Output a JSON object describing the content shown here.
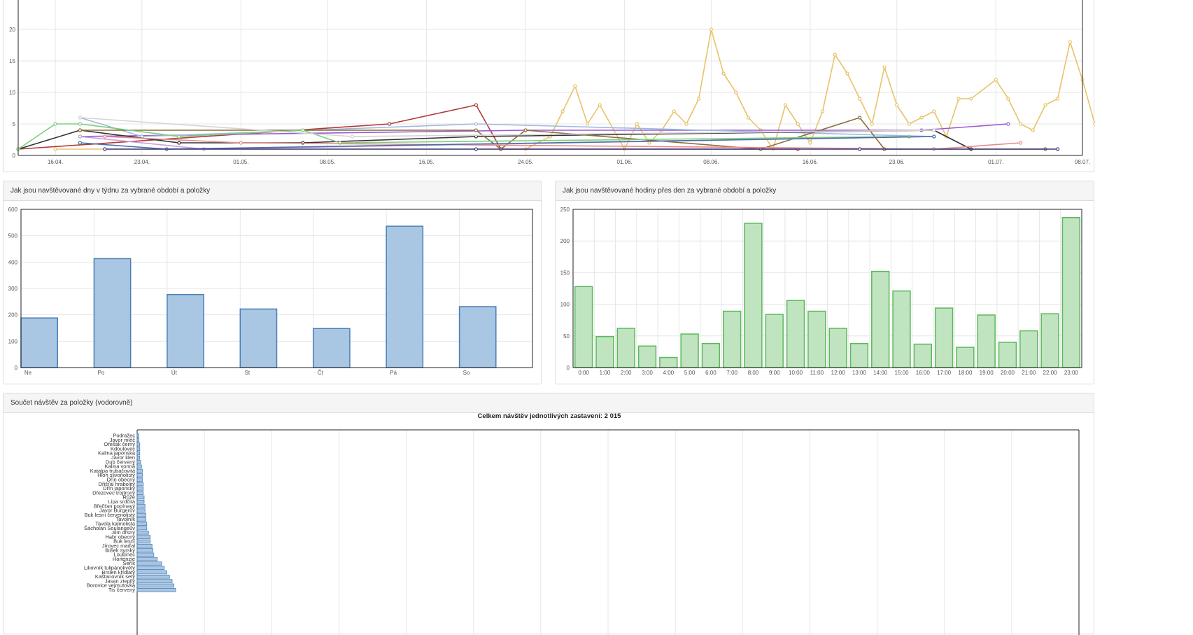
{
  "line_panel": {
    "chart_data": {
      "type": "line",
      "ylim": [
        0,
        25
      ],
      "yticks": [
        "0",
        "5",
        "10",
        "15",
        "20"
      ],
      "x_dates": [
        "16.04.",
        "23.04.",
        "01.05.",
        "08.05.",
        "16.05.",
        "24.05.",
        "01.06.",
        "08.06.",
        "16.06.",
        "23.06.",
        "01.07.",
        "08.07."
      ],
      "xlim": [
        "2018-04-13",
        "2018-07-08"
      ],
      "grid": true,
      "series": [
        {
          "color": "#e8c36a",
          "points": [
            [
              "2018-04-16",
              1
            ],
            [
              "2018-05-24",
              1
            ],
            [
              "2018-05-26",
              3
            ],
            [
              "2018-05-27",
              7
            ],
            [
              "2018-05-28",
              11
            ],
            [
              "2018-05-29",
              5
            ],
            [
              "2018-05-30",
              8
            ],
            [
              "2018-06-01",
              1
            ],
            [
              "2018-06-02",
              5
            ],
            [
              "2018-06-03",
              2
            ],
            [
              "2018-06-04",
              4
            ],
            [
              "2018-06-05",
              7
            ],
            [
              "2018-06-06",
              5
            ],
            [
              "2018-06-07",
              9
            ],
            [
              "2018-06-08",
              20
            ],
            [
              "2018-06-09",
              13
            ],
            [
              "2018-06-10",
              10
            ],
            [
              "2018-06-11",
              6
            ],
            [
              "2018-06-12",
              4
            ],
            [
              "2018-06-13",
              1
            ],
            [
              "2018-06-14",
              8
            ],
            [
              "2018-06-15",
              5
            ],
            [
              "2018-06-16",
              2
            ],
            [
              "2018-06-17",
              7
            ],
            [
              "2018-06-18",
              16
            ],
            [
              "2018-06-19",
              13
            ],
            [
              "2018-06-20",
              9
            ],
            [
              "2018-06-21",
              5
            ],
            [
              "2018-06-22",
              14
            ],
            [
              "2018-06-23",
              8
            ],
            [
              "2018-06-24",
              5
            ],
            [
              "2018-06-25",
              6
            ],
            [
              "2018-06-26",
              7
            ],
            [
              "2018-06-27",
              3
            ],
            [
              "2018-06-28",
              9
            ],
            [
              "2018-06-29",
              9
            ],
            [
              "2018-07-01",
              12
            ],
            [
              "2018-07-02",
              9
            ],
            [
              "2018-07-03",
              5
            ],
            [
              "2018-07-04",
              4
            ],
            [
              "2018-07-05",
              8
            ],
            [
              "2018-07-06",
              9
            ],
            [
              "2018-07-07",
              18
            ],
            [
              "2018-07-08",
              12
            ],
            [
              "2018-07-09",
              5
            ]
          ]
        },
        {
          "color": "#b03a3a",
          "points": [
            [
              "2018-04-13",
              1
            ],
            [
              "2018-05-13",
              5
            ],
            [
              "2018-05-20",
              8
            ],
            [
              "2018-05-22",
              1
            ],
            [
              "2018-06-15",
              1
            ]
          ]
        },
        {
          "color": "#9b59d6",
          "points": [
            [
              "2018-04-18",
              3
            ],
            [
              "2018-05-24",
              4
            ],
            [
              "2018-06-25",
              4
            ],
            [
              "2018-07-02",
              5
            ]
          ]
        },
        {
          "color": "#a0b8e0",
          "points": [
            [
              "2018-04-18",
              6
            ],
            [
              "2018-04-23",
              3
            ],
            [
              "2018-05-20",
              5
            ],
            [
              "2018-06-26",
              3
            ]
          ]
        },
        {
          "color": "#333333",
          "points": [
            [
              "2018-04-13",
              1
            ],
            [
              "2018-04-18",
              4
            ],
            [
              "2018-04-26",
              2
            ],
            [
              "2018-05-06",
              2
            ],
            [
              "2018-05-20",
              3
            ],
            [
              "2018-06-26",
              4
            ],
            [
              "2018-06-29",
              1
            ]
          ]
        },
        {
          "color": "#8c6d3a",
          "points": [
            [
              "2018-04-18",
              4
            ],
            [
              "2018-05-20",
              4
            ],
            [
              "2018-05-22",
              1
            ],
            [
              "2018-05-24",
              4
            ],
            [
              "2018-06-12",
              1
            ],
            [
              "2018-06-20",
              6
            ],
            [
              "2018-06-22",
              1
            ],
            [
              "2018-07-05",
              1
            ]
          ]
        },
        {
          "color": "#7ccf7c",
          "points": [
            [
              "2018-04-13",
              1
            ],
            [
              "2018-04-16",
              5
            ],
            [
              "2018-04-18",
              5
            ],
            [
              "2018-04-26",
              3
            ],
            [
              "2018-05-06",
              4
            ],
            [
              "2018-05-09",
              2
            ],
            [
              "2018-06-24",
              3
            ]
          ]
        },
        {
          "color": "#e88a8a",
          "points": [
            [
              "2018-04-20",
              3
            ],
            [
              "2018-05-01",
              2
            ],
            [
              "2018-06-26",
              1
            ],
            [
              "2018-07-03",
              2
            ]
          ]
        },
        {
          "color": "#c9a0dc",
          "points": [
            [
              "2018-04-18",
              3
            ],
            [
              "2018-04-28",
              1
            ],
            [
              "2018-06-26",
              3
            ]
          ]
        },
        {
          "color": "#4a6fa5",
          "points": [
            [
              "2018-04-18",
              2
            ],
            [
              "2018-04-25",
              1
            ],
            [
              "2018-06-26",
              3
            ]
          ]
        },
        {
          "color": "#3a3a80",
          "points": [
            [
              "2018-04-20",
              1
            ],
            [
              "2018-05-20",
              1
            ],
            [
              "2018-06-20",
              1
            ],
            [
              "2018-07-06",
              1
            ]
          ]
        },
        {
          "color": "#d4d4d4",
          "points": [
            [
              "2018-04-18",
              6
            ],
            [
              "2018-05-10",
              3
            ],
            [
              "2018-06-26",
              4
            ]
          ]
        }
      ]
    }
  },
  "weekday_panel": {
    "heading": "Jak jsou navštěvované dny v týdnu za vybrané období a položky",
    "chart_data": {
      "type": "bar",
      "categories": [
        "Ne",
        "Po",
        "Út",
        "St",
        "Čt",
        "Pá",
        "So"
      ],
      "values": [
        188,
        413,
        277,
        222,
        148,
        536,
        231
      ],
      "ylim": [
        0,
        600
      ],
      "yticks": [
        "0",
        "100",
        "200",
        "300",
        "400",
        "500",
        "600"
      ],
      "color": "#a9c6e3",
      "stroke": "#4a7fb5",
      "grid": true
    }
  },
  "hours_panel": {
    "heading": "Jak jsou navštěvované hodiny přes den za vybrané období a položky",
    "chart_data": {
      "type": "bar",
      "categories": [
        "0:00",
        "1:00",
        "2:00",
        "3:00",
        "4:00",
        "5:00",
        "6:00",
        "7:00",
        "8:00",
        "9:00",
        "10:00",
        "11:00",
        "12:00",
        "13:00",
        "14:00",
        "15:00",
        "16:00",
        "17:00",
        "18:00",
        "19:00",
        "20:00",
        "21:00",
        "22:00",
        "23:00"
      ],
      "values": [
        128,
        49,
        62,
        34,
        16,
        53,
        38,
        89,
        228,
        84,
        106,
        89,
        62,
        38,
        152,
        121,
        37,
        94,
        32,
        83,
        40,
        58,
        85,
        237
      ],
      "ylim": [
        0,
        250
      ],
      "yticks": [
        "0",
        "50",
        "100",
        "150",
        "200",
        "250"
      ],
      "color": "#bfe4bf",
      "stroke": "#5cb85c",
      "grid": true
    }
  },
  "items_panel": {
    "heading": "Součet návštěv za položky (vodorovně)",
    "chart_data": {
      "type": "bar",
      "orientation": "horizontal",
      "title": "Celkem návštěv jednotlivých zastavení: 2 015",
      "categories": [
        "Podražec",
        "Javor mléč",
        "Ořešák černý",
        "Kdoulovec",
        "Kalina japonská",
        "Javor klen",
        "Dub červený",
        "Kalina vonná",
        "Katalpa trubačovitá",
        "Hloh slivoňolistý",
        "Dřín obecný",
        "Dřišťál hrabolitý",
        "Dřín japonský",
        "Dřezovec trojtrnný",
        "Růže",
        "Lípa srdčitá",
        "Břečťan popínavý",
        "Javor Burgerův",
        "Buk lesní červenolistý",
        "Tavolník",
        "Tavola kalinolistá",
        "Šácholan Soulangeův",
        "Jilm drsný",
        "Habr obecný",
        "Buk lesní",
        "Jírovec maďal",
        "Ibišek syrský",
        "Loubinec",
        "Hortenzie",
        "Šeřík",
        "Liliovník tulipánokvětý",
        "Brslen křídlatý",
        "Kaštanovník setý",
        "Jasan ztepilý",
        "Borovice vejmutovka",
        "Tis červený"
      ],
      "values": [
        2,
        2,
        3,
        3,
        3,
        3,
        4,
        5,
        6,
        6,
        6,
        7,
        7,
        7,
        8,
        8,
        9,
        9,
        10,
        10,
        11,
        11,
        13,
        15,
        15,
        17,
        18,
        19,
        23,
        28,
        31,
        34,
        37,
        40,
        42,
        44
      ],
      "color": "#a9c6e3",
      "stroke": "#4a7fb5",
      "grid": true
    }
  }
}
